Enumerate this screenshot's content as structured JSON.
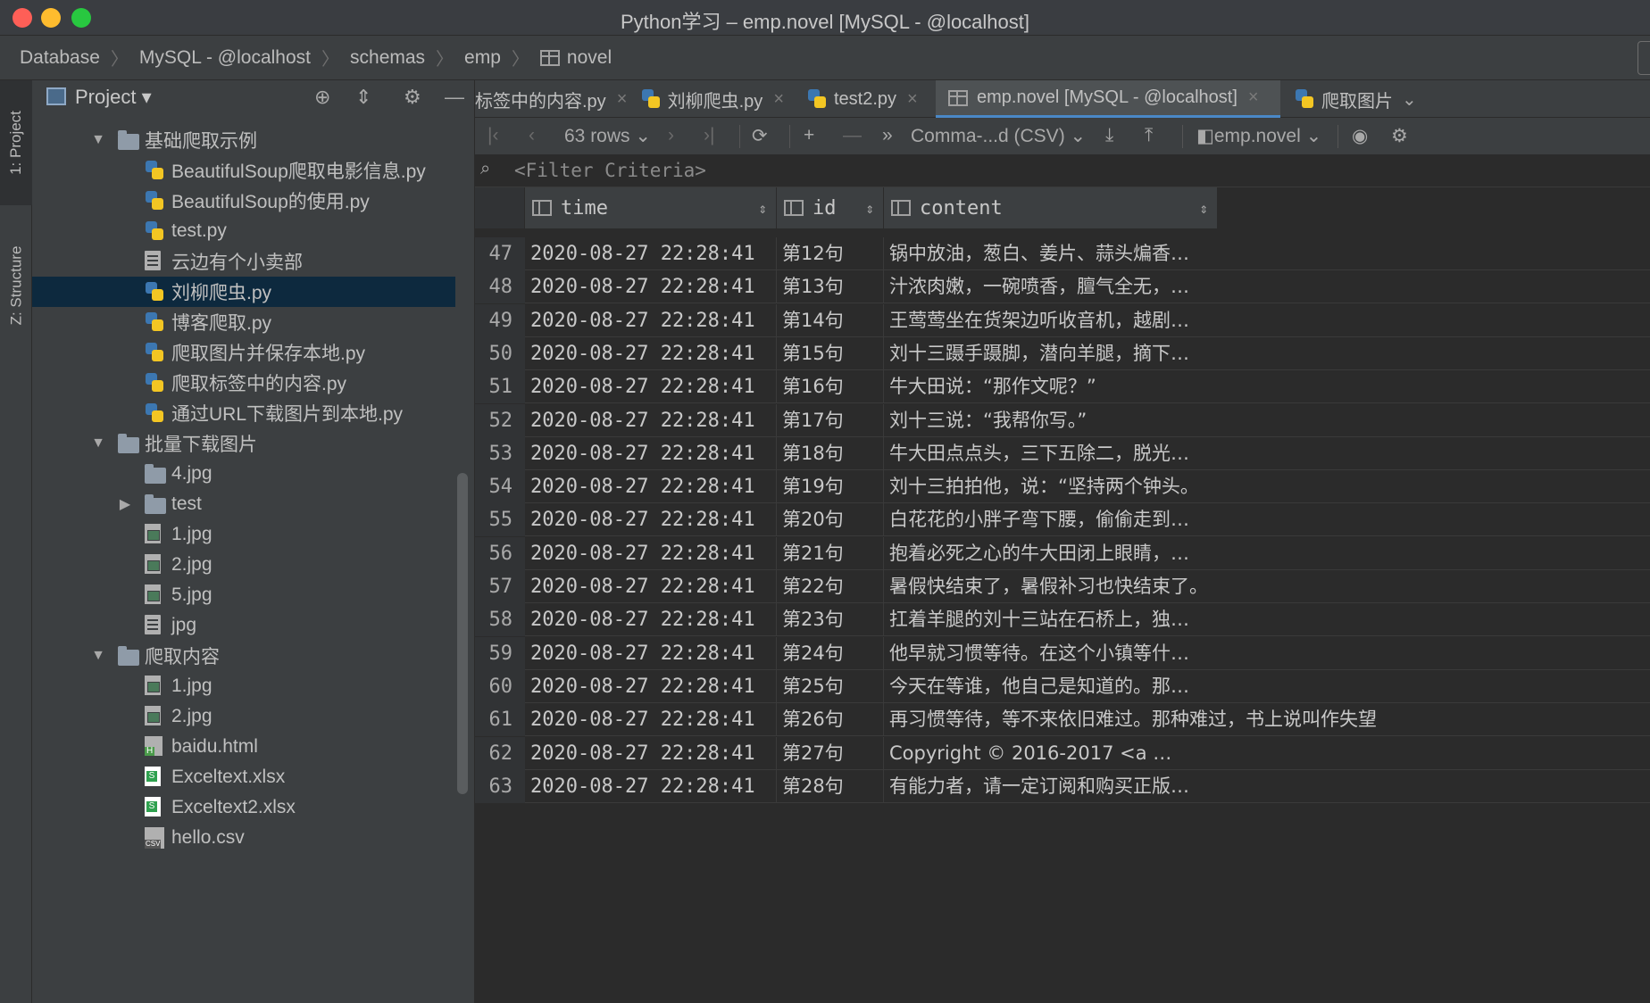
{
  "window": {
    "title": "Python学习 – emp.novel [MySQL - @localhost]"
  },
  "breadcrumb": [
    {
      "label": "Database",
      "icon": ""
    },
    {
      "label": "MySQL - @localhost",
      "icon": ""
    },
    {
      "label": "schemas",
      "icon": ""
    },
    {
      "label": "emp",
      "icon": ""
    },
    {
      "label": "novel",
      "icon": "table-icon"
    }
  ],
  "toolstripe": {
    "project_tab": "1: Project",
    "structure_tab": "Z: Structure"
  },
  "project_panel": {
    "title": "Project",
    "tree": [
      {
        "label": "基础爬取示例",
        "type": "folder",
        "expanded": true,
        "depth": 1
      },
      {
        "label": "BeautifulSoup爬取电影信息.py",
        "type": "py",
        "depth": 2
      },
      {
        "label": "BeautifulSoup的使用.py",
        "type": "py",
        "depth": 2
      },
      {
        "label": "test.py",
        "type": "py",
        "depth": 2
      },
      {
        "label": "云边有个小卖部",
        "type": "file",
        "depth": 2
      },
      {
        "label": "刘柳爬虫.py",
        "type": "py",
        "depth": 2,
        "selected": true
      },
      {
        "label": "博客爬取.py",
        "type": "py",
        "depth": 2
      },
      {
        "label": "爬取图片并保存本地.py",
        "type": "py",
        "depth": 2
      },
      {
        "label": "爬取标签中的内容.py",
        "type": "py",
        "depth": 2
      },
      {
        "label": "通过URL下载图片到本地.py",
        "type": "py",
        "depth": 2
      },
      {
        "label": "批量下载图片",
        "type": "folder",
        "expanded": true,
        "depth": 1
      },
      {
        "label": "4.jpg",
        "type": "folder",
        "depth": 2
      },
      {
        "label": "test",
        "type": "folder",
        "collapsed": true,
        "depth": 2
      },
      {
        "label": "1.jpg",
        "type": "img",
        "depth": 2
      },
      {
        "label": "2.jpg",
        "type": "img",
        "depth": 2
      },
      {
        "label": "5.jpg",
        "type": "img",
        "depth": 2
      },
      {
        "label": "jpg",
        "type": "file",
        "depth": 2
      },
      {
        "label": "爬取内容",
        "type": "folder",
        "expanded": true,
        "depth": 1
      },
      {
        "label": "1.jpg",
        "type": "img",
        "depth": 2
      },
      {
        "label": "2.jpg",
        "type": "img",
        "depth": 2
      },
      {
        "label": "baidu.html",
        "type": "html",
        "depth": 2
      },
      {
        "label": "Exceltext.xlsx",
        "type": "xlsx",
        "depth": 2
      },
      {
        "label": "Exceltext2.xlsx",
        "type": "xlsx",
        "depth": 2
      },
      {
        "label": "hello.csv",
        "type": "csv",
        "depth": 2
      }
    ]
  },
  "editor_tabs": [
    {
      "label": "标签中的内容.py",
      "icon": "none",
      "active": false
    },
    {
      "label": "刘柳爬虫.py",
      "icon": "python-icon",
      "active": false
    },
    {
      "label": "test2.py",
      "icon": "python-icon",
      "active": false
    },
    {
      "label": "emp.novel [MySQL - @localhost]",
      "icon": "table-icon",
      "active": true
    },
    {
      "label": "爬取图片",
      "icon": "python-icon",
      "active": false
    }
  ],
  "data_toolbar": {
    "rows": "63 rows",
    "export_format": "Comma-...d (CSV)",
    "datasource": "emp.novel"
  },
  "filter": {
    "placeholder": "<Filter Criteria>"
  },
  "grid": {
    "columns": [
      "time",
      "id",
      "content"
    ],
    "rows": [
      {
        "n": "47",
        "time": "2020-08-27 22:28:41",
        "id": "第12句",
        "content": "锅中放油，葱白、姜片、蒜头煸香…"
      },
      {
        "n": "48",
        "time": "2020-08-27 22:28:41",
        "id": "第13句",
        "content": "汁浓肉嫩，一碗喷香，膻气全无，…"
      },
      {
        "n": "49",
        "time": "2020-08-27 22:28:41",
        "id": "第14句",
        "content": "王莺莺坐在货架边听收音机，越剧…"
      },
      {
        "n": "50",
        "time": "2020-08-27 22:28:41",
        "id": "第15句",
        "content": "刘十三蹑手蹑脚，潜向羊腿，摘下…"
      },
      {
        "n": "51",
        "time": "2020-08-27 22:28:41",
        "id": "第16句",
        "content": "牛大田说：“那作文呢？”"
      },
      {
        "n": "52",
        "time": "2020-08-27 22:28:41",
        "id": "第17句",
        "content": "刘十三说：“我帮你写。”"
      },
      {
        "n": "53",
        "time": "2020-08-27 22:28:41",
        "id": "第18句",
        "content": "牛大田点点头，三下五除二，脱光…"
      },
      {
        "n": "54",
        "time": "2020-08-27 22:28:41",
        "id": "第19句",
        "content": "刘十三拍拍他，说：“坚持两个钟头。"
      },
      {
        "n": "55",
        "time": "2020-08-27 22:28:41",
        "id": "第20句",
        "content": "白花花的小胖子弯下腰，偷偷走到…"
      },
      {
        "n": "56",
        "time": "2020-08-27 22:28:41",
        "id": "第21句",
        "content": "抱着必死之心的牛大田闭上眼睛，…"
      },
      {
        "n": "57",
        "time": "2020-08-27 22:28:41",
        "id": "第22句",
        "content": "暑假快结束了，暑假补习也快结束了。"
      },
      {
        "n": "58",
        "time": "2020-08-27 22:28:41",
        "id": "第23句",
        "content": "扛着羊腿的刘十三站在石桥上，独…"
      },
      {
        "n": "59",
        "time": "2020-08-27 22:28:41",
        "id": "第24句",
        "content": "他早就习惯等待。在这个小镇等什…"
      },
      {
        "n": "60",
        "time": "2020-08-27 22:28:41",
        "id": "第25句",
        "content": "今天在等谁，他自己是知道的。那…"
      },
      {
        "n": "61",
        "time": "2020-08-27 22:28:41",
        "id": "第26句",
        "content": "再习惯等待，等不来依旧难过。那种难过，书上说叫作失望"
      },
      {
        "n": "62",
        "time": "2020-08-27 22:28:41",
        "id": "第27句",
        "content": "Copyright © 2016-2017 <a …"
      },
      {
        "n": "63",
        "time": "2020-08-27 22:28:41",
        "id": "第28句",
        "content": "有能力者，请一定订阅和购买正版…"
      }
    ]
  }
}
